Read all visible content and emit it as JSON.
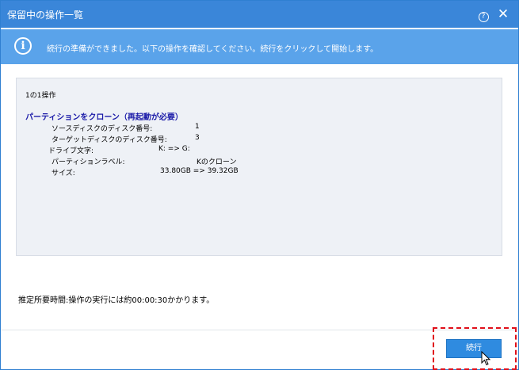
{
  "window": {
    "title": "保留中の操作一覧",
    "help_glyph": "?",
    "close_glyph": "✕"
  },
  "info": {
    "icon_glyph": "i",
    "message": "続行の準備ができました。以下の操作を確認してください。続行をクリックして開始します。"
  },
  "operations": {
    "count": "1の1操作",
    "title": "パーティションをクローン（再起動が必要）",
    "details": [
      {
        "label": "ソースディスクのディスク番号:",
        "value": "1"
      },
      {
        "label": "ターゲットディスクのディスク番号:",
        "value": "3"
      },
      {
        "label": "ドライブ文字:",
        "value": "K: => G:"
      },
      {
        "label": "パーティションラベル:",
        "value": "Kのクローン"
      },
      {
        "label": "サイズ:",
        "value": "33.80GB => 39.32GB"
      }
    ]
  },
  "estimate": "推定所要時間:操作の実行には約00:00:30かかります。",
  "buttons": {
    "proceed": "続行"
  },
  "colors": {
    "titlebar": "#3a86d9",
    "infobar": "#5aa3ea",
    "button": "#2f8be0",
    "highlight": "#e0101a",
    "operation_title": "#1a1aa8"
  }
}
